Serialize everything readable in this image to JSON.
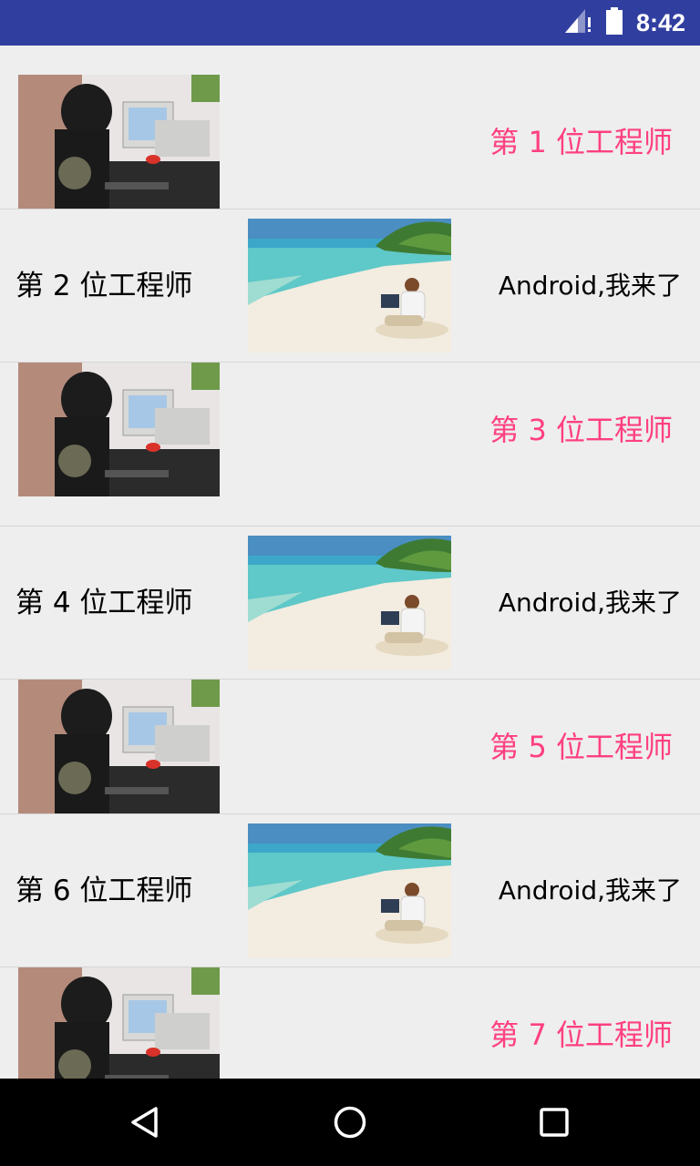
{
  "status_bar": {
    "time": "8:42"
  },
  "rows": [
    {
      "kind": "image-left",
      "image": "person-at-computer",
      "label": "第 1 位工程师"
    },
    {
      "kind": "image-center",
      "image": "beach-laptop",
      "left_label": "第 2 位工程师",
      "right_label": "Android,我来了"
    },
    {
      "kind": "image-left",
      "image": "person-at-computer",
      "label": "第 3 位工程师"
    },
    {
      "kind": "image-center",
      "image": "beach-laptop",
      "left_label": "第 4 位工程师",
      "right_label": "Android,我来了"
    },
    {
      "kind": "image-left",
      "image": "person-at-computer",
      "label": "第 5 位工程师"
    },
    {
      "kind": "image-center",
      "image": "beach-laptop",
      "left_label": "第 6 位工程师",
      "right_label": "Android,我来了"
    },
    {
      "kind": "image-left",
      "image": "person-at-computer",
      "label": "第 7 位工程师"
    }
  ],
  "colors": {
    "status_bar": "#303f9f",
    "accent_pink": "#ff4081",
    "background": "#eeeeee"
  },
  "nav": {
    "back_icon": "back-triangle-icon",
    "home_icon": "home-circle-icon",
    "recents_icon": "recents-square-icon"
  }
}
